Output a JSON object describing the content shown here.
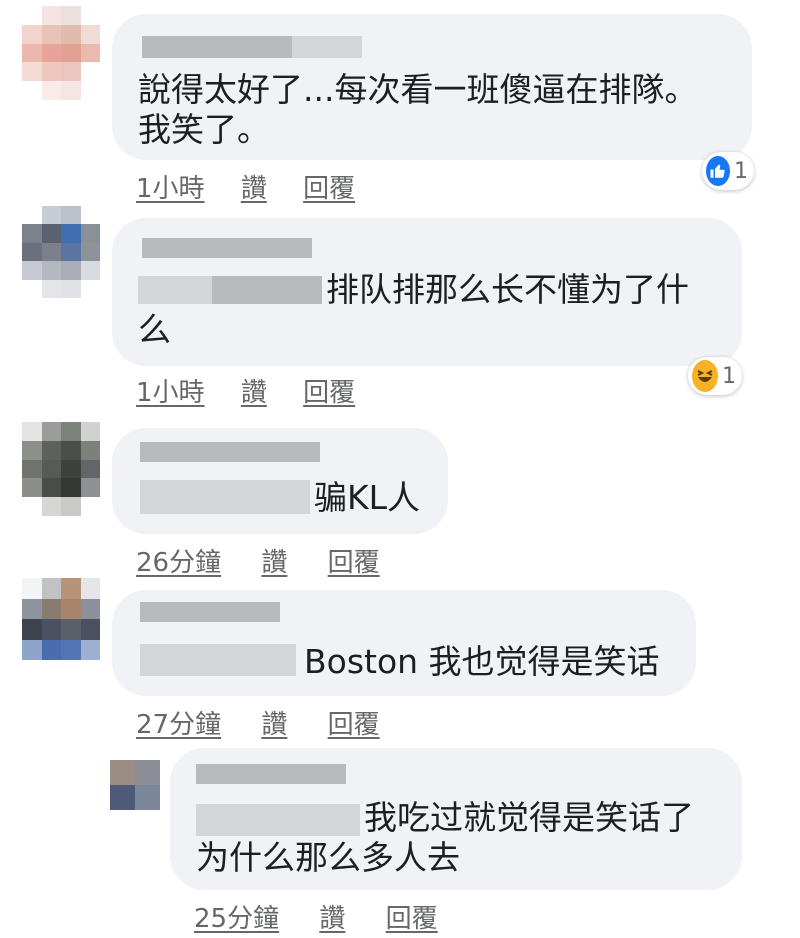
{
  "comments": [
    {
      "text": "說得太好了...每次看一班傻逼在排隊。\n我笑了。",
      "time": "1小時",
      "like": "讚",
      "reply": "回覆",
      "reaction": {
        "icon": "like-icon",
        "count": "1",
        "color": "#1877f2"
      }
    },
    {
      "text": "排队排那么长不懂为了什\n么",
      "time": "1小時",
      "like": "讚",
      "reply": "回覆",
      "reaction": {
        "icon": "haha-icon",
        "count": "1",
        "color": "#f7b125"
      }
    },
    {
      "text": "骗KL人",
      "time": "26分鐘",
      "like": "讚",
      "reply": "回覆"
    },
    {
      "text": "Boston 我也觉得是笑话",
      "time": "27分鐘",
      "like": "讚",
      "reply": "回覆"
    },
    {
      "text": "我吃过就觉得是笑话了\n为什么那么多人去",
      "time": "25分鐘",
      "like": "讚",
      "reply": "回覆"
    }
  ],
  "colors": {
    "bubble": "#f0f2f5",
    "meta_text": "#65676b",
    "body_text": "#1c1e21"
  }
}
